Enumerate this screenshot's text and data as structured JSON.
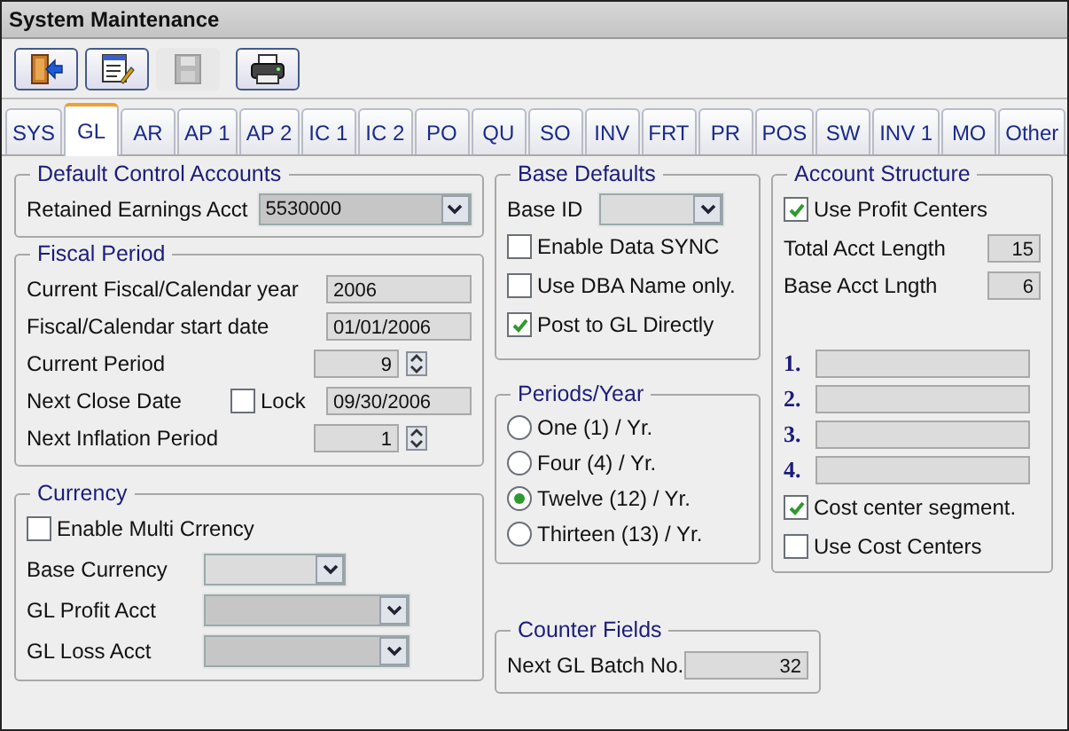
{
  "window": {
    "title": "System Maintenance"
  },
  "toolbar": [
    {
      "kind": "exit",
      "disabled": false
    },
    {
      "kind": "edit",
      "disabled": false
    },
    {
      "kind": "save",
      "disabled": true
    },
    {
      "kind": "print",
      "disabled": false
    }
  ],
  "tabs": [
    {
      "label": "SYS",
      "selected": false
    },
    {
      "label": "GL",
      "selected": true
    },
    {
      "label": "AR",
      "selected": false
    },
    {
      "label": "AP 1",
      "selected": false
    },
    {
      "label": "AP 2",
      "selected": false
    },
    {
      "label": "IC 1",
      "selected": false
    },
    {
      "label": "IC 2",
      "selected": false
    },
    {
      "label": "PO",
      "selected": false
    },
    {
      "label": "QU",
      "selected": false
    },
    {
      "label": "SO",
      "selected": false
    },
    {
      "label": "INV",
      "selected": false
    },
    {
      "label": "FRT",
      "selected": false
    },
    {
      "label": "PR",
      "selected": false
    },
    {
      "label": "POS",
      "selected": false
    },
    {
      "label": "SW",
      "selected": false
    },
    {
      "label": "INV 1",
      "selected": false
    },
    {
      "label": "MO",
      "selected": false
    },
    {
      "label": "Other",
      "selected": false
    }
  ],
  "default_control_accounts": {
    "title": "Default Control Accounts",
    "retained_earnings": {
      "label": "Retained Earnings Acct",
      "value": "5530000"
    }
  },
  "fiscal_period": {
    "title": "Fiscal Period",
    "rows": [
      {
        "kind": "text",
        "label": "Current Fiscal/Calendar year",
        "value": "2006"
      },
      {
        "kind": "text",
        "label": "Fiscal/Calendar start date",
        "value": "01/01/2006"
      },
      {
        "kind": "spin",
        "label": "Current Period",
        "value": "9"
      },
      {
        "kind": "lock",
        "label": "Next Close Date",
        "lock": {
          "label": "Lock",
          "checked": false
        },
        "value": "09/30/2006"
      },
      {
        "kind": "spin",
        "label": "Next Inflation Period",
        "value": "1"
      }
    ]
  },
  "currency": {
    "title": "Currency",
    "multi_currency": {
      "label": "Enable Multi Crrency",
      "checked": false
    },
    "dropdowns": [
      {
        "label": "Base Currency"
      },
      {
        "label": "GL Profit Acct"
      },
      {
        "label": "GL Loss Acct"
      }
    ]
  },
  "base_defaults": {
    "title": "Base Defaults",
    "base_id": {
      "label": "Base ID"
    },
    "options": [
      {
        "label": "Enable Data SYNC",
        "checked": false
      },
      {
        "label": "Use DBA Name only.",
        "checked": false
      },
      {
        "label": "Post to GL Directly",
        "checked": true
      }
    ]
  },
  "periods_year": {
    "title": "Periods/Year",
    "options": [
      {
        "label": "One (1) / Yr.",
        "selected": false
      },
      {
        "label": "Four (4) / Yr.",
        "selected": false
      },
      {
        "label": "Twelve (12) / Yr.",
        "selected": true
      },
      {
        "label": "Thirteen  (13) / Yr.",
        "selected": false
      }
    ]
  },
  "counter_fields": {
    "title": "Counter Fields",
    "rows": [
      {
        "label": "Next GL Batch No.",
        "value": "32"
      }
    ]
  },
  "account_structure": {
    "title": "Account Structure",
    "use_profit_centers": {
      "label": "Use Profit Centers",
      "checked": true
    },
    "lengths": [
      {
        "label": "Total Acct Length",
        "value": "15"
      },
      {
        "label": "Base Acct Lngth",
        "value": "6"
      }
    ],
    "segments": [
      {
        "label": "1."
      },
      {
        "label": "2."
      },
      {
        "label": "3."
      },
      {
        "label": "4."
      }
    ],
    "options": [
      {
        "label": "Cost center segment.",
        "checked": true
      },
      {
        "label": "Use Cost Centers",
        "checked": false
      }
    ]
  }
}
